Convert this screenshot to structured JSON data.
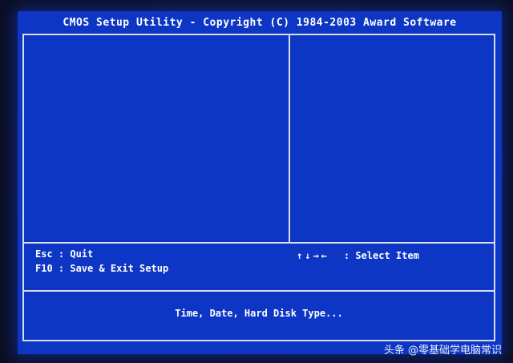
{
  "title": "CMOS Setup Utility - Copyright (C) 1984-2003 Award Software",
  "keys": {
    "esc": "Esc  : Quit",
    "f10": "F10  : Save & Exit Setup",
    "nav_arrows": "↑↓→←",
    "nav_label": ": Select Item"
  },
  "help_text": "Time, Date, Hard Disk Type...",
  "watermark": "头条 @零基础学电脑常识",
  "colors": {
    "bios_blue": "#0d36c4",
    "frame_line": "#d9dcf0",
    "text": "#ffffff"
  }
}
